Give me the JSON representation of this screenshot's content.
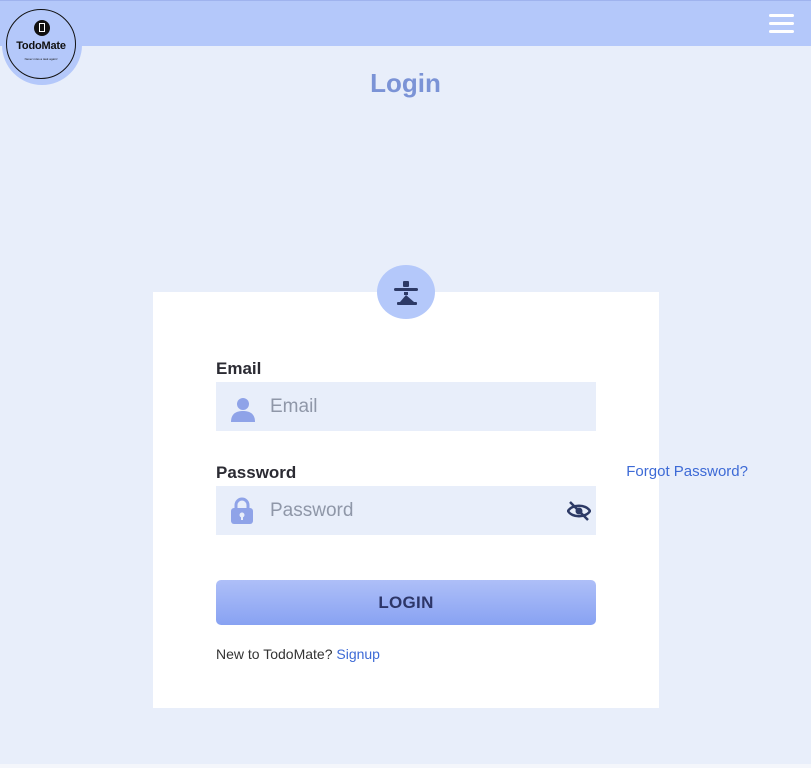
{
  "app": {
    "logo_name": "TodoMate",
    "logo_tagline": "Never miss a task again!"
  },
  "header": {
    "menu_icon": "hamburger-icon"
  },
  "page": {
    "title": "Login"
  },
  "form": {
    "badge_icon": "user-tie-icon",
    "email": {
      "label": "Email",
      "placeholder": "Email",
      "value": "",
      "icon": "user-icon"
    },
    "password": {
      "label": "Password",
      "placeholder": "Password",
      "value": "",
      "icon": "lock-icon",
      "toggle_icon": "eye-slash-icon"
    },
    "forgot_label": "Forgot Password?",
    "submit_label": "LOGIN",
    "signup_prompt": "New to TodoMate?",
    "signup_link": "Signup"
  },
  "colors": {
    "header_bg": "#b4c8fa",
    "page_bg": "#e8eefa",
    "title": "#7b93d6",
    "link": "#3d6ad6",
    "button_top": "#aebff8",
    "button_bottom": "#88a2f2"
  }
}
